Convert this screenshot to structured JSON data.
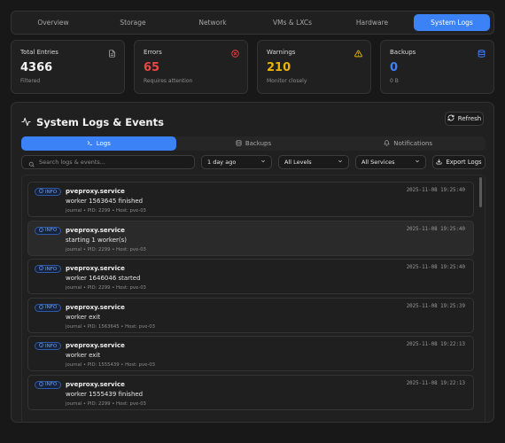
{
  "tabs": [
    {
      "label": "Overview"
    },
    {
      "label": "Storage"
    },
    {
      "label": "Network"
    },
    {
      "label": "VMs & LXCs"
    },
    {
      "label": "Hardware"
    },
    {
      "label": "System Logs"
    }
  ],
  "active_tab": "System Logs",
  "cards": [
    {
      "label": "Total Entries",
      "value": "4366",
      "sub": "Filtered",
      "icon": "file-text-icon",
      "value_color": "#f2f2f2",
      "icon_color": "#a6a6a6"
    },
    {
      "label": "Errors",
      "value": "65",
      "sub": "Requires attention",
      "icon": "x-circle-icon",
      "value_color": "#ef4444",
      "icon_color": "#ef4444"
    },
    {
      "label": "Warnings",
      "value": "210",
      "sub": "Monitor closely",
      "icon": "warning-triangle-icon",
      "value_color": "#eab308",
      "icon_color": "#eab308"
    },
    {
      "label": "Backups",
      "value": "0",
      "sub": "0 B",
      "icon": "database-icon",
      "value_color": "#3b82f6",
      "icon_color": "#3b82f6"
    }
  ],
  "panel": {
    "title": "System Logs & Events",
    "title_icon": "activity-icon",
    "refresh_label": "Refresh"
  },
  "subtabs": [
    {
      "label": "Logs",
      "icon": "terminal-icon"
    },
    {
      "label": "Backups",
      "icon": "database-icon"
    },
    {
      "label": "Notifications",
      "icon": "bell-icon"
    }
  ],
  "filters": {
    "search_placeholder": "Search logs & events...",
    "time_range": "1 day ago",
    "level": "All Levels",
    "service": "All Services",
    "export_label": "Export Logs"
  },
  "logs": [
    {
      "level": "INFO",
      "service": "pveproxy.service",
      "message": "worker 1563645 finished",
      "meta": "journal • PID: 2299 • Host: pve-03",
      "timestamp": "2025-11-08 19:25:40"
    },
    {
      "level": "INFO",
      "service": "pveproxy.service",
      "message": "starting 1 worker(s)",
      "meta": "journal • PID: 2299 • Host: pve-03",
      "timestamp": "2025-11-08 19:25:40"
    },
    {
      "level": "INFO",
      "service": "pveproxy.service",
      "message": "worker 1646046 started",
      "meta": "journal • PID: 2299 • Host: pve-03",
      "timestamp": "2025-11-08 19:25:40"
    },
    {
      "level": "INFO",
      "service": "pveproxy.service",
      "message": "worker exit",
      "meta": "journal • PID: 1563645 • Host: pve-03",
      "timestamp": "2025-11-08 19:25:39"
    },
    {
      "level": "INFO",
      "service": "pveproxy.service",
      "message": "worker exit",
      "meta": "journal • PID: 1555439 • Host: pve-03",
      "timestamp": "2025-11-08 19:22:13"
    },
    {
      "level": "INFO",
      "service": "pveproxy.service",
      "message": "worker 1555439 finished",
      "meta": "journal • PID: 2299 • Host: pve-03",
      "timestamp": "2025-11-08 19:22:13"
    }
  ],
  "colors": {
    "accent": "#3b82f6",
    "info": "#6fa0ff"
  }
}
